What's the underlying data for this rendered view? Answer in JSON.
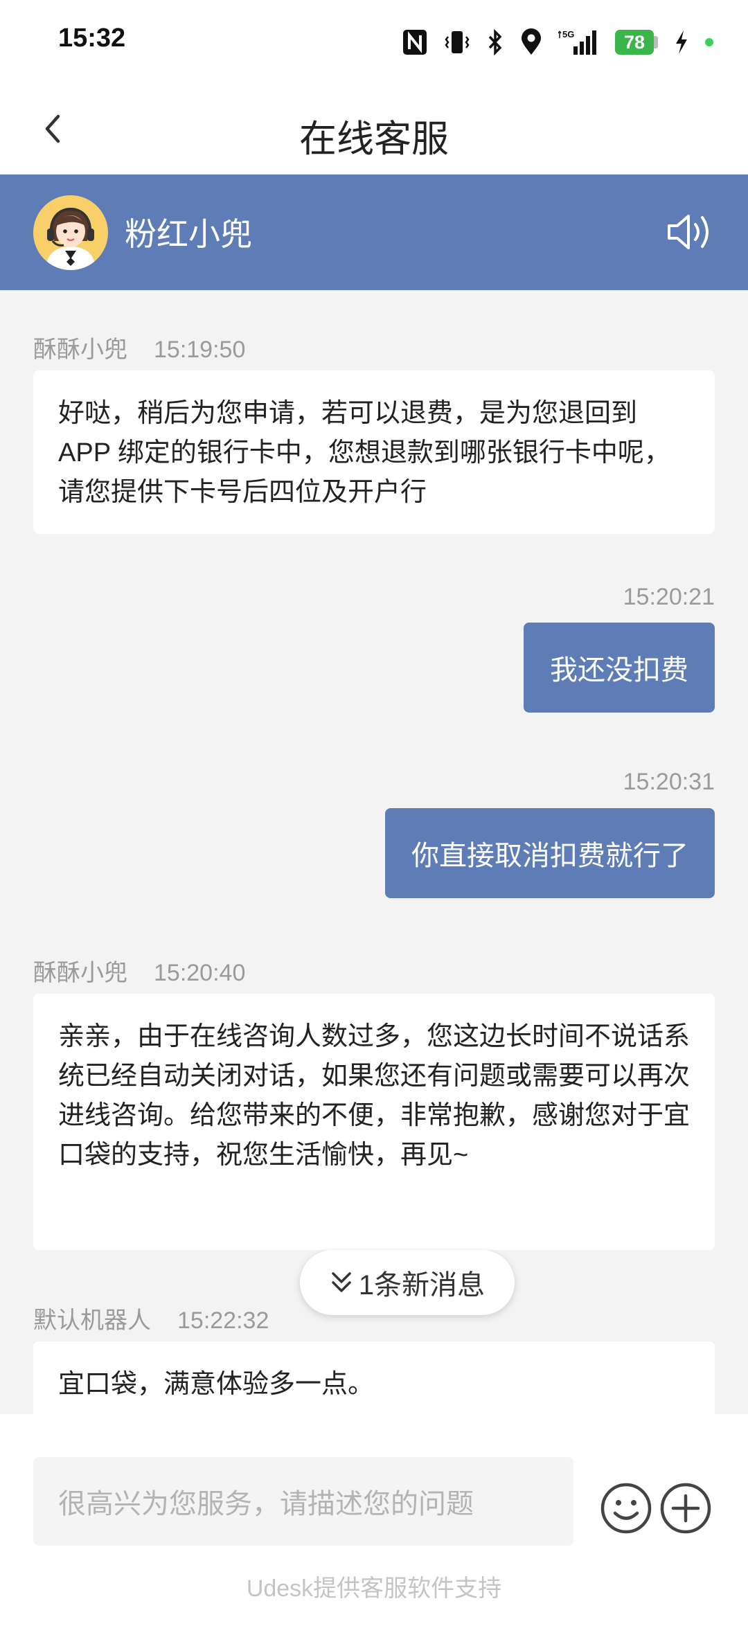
{
  "status_bar": {
    "time": "15:32",
    "battery": "78",
    "network": "5G"
  },
  "header": {
    "title": "在线客服"
  },
  "agent": {
    "name": "粉红小兜"
  },
  "messages": [
    {
      "sender": "酥酥小兜",
      "time": "15:19:50",
      "text": "好哒，稍后为您申请，若可以退费，是为您退回到 APP 绑定的银行卡中，您想退款到哪张银行卡中呢，请您提供下卡号后四位及开户行"
    },
    {
      "time": "15:20:21",
      "text": "我还没扣费"
    },
    {
      "time": "15:20:31",
      "text": "你直接取消扣费就行了"
    },
    {
      "sender": "酥酥小兜",
      "time": "15:20:40",
      "text": "亲亲，由于在线咨询人数过多，您这边长时间不说话系统已经自动关闭对话，如果您还有问题或需要可以再次进线咨询。给您带来的不便，非常抱歉，感谢您对于宜口袋的支持，祝您生活愉快，再见~"
    },
    {
      "sender": "默认机器人",
      "time": "15:22:32",
      "text": "宜口袋，满意体验多一点。"
    }
  ],
  "new_message_badge": "1条新消息",
  "input": {
    "placeholder": "很高兴为您服务，请描述您的问题"
  },
  "footer": {
    "note": "Udesk提供客服软件支持"
  },
  "colors": {
    "accent": "#5e7db7",
    "background": "#f3f3f3",
    "battery": "#3ab54a"
  }
}
